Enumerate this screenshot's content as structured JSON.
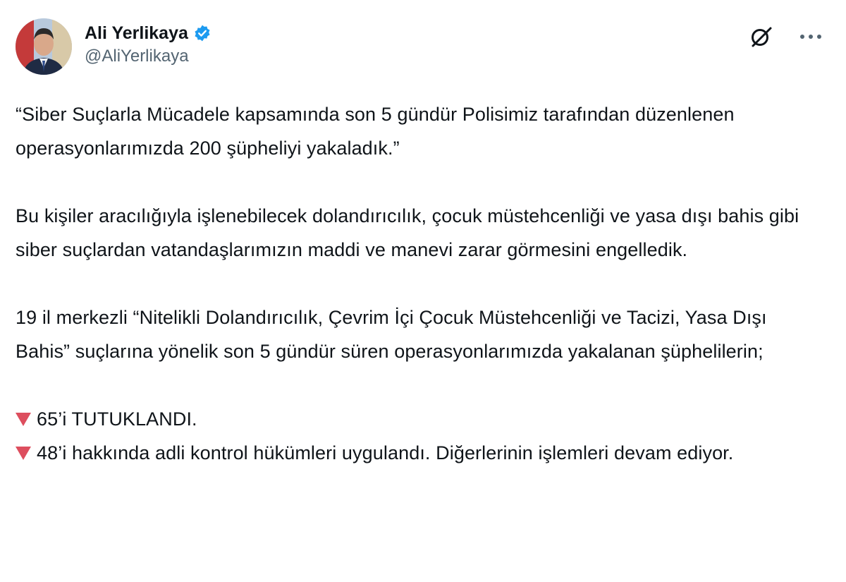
{
  "author": {
    "display_name": "Ali Yerlikaya",
    "handle": "@AliYerlikaya",
    "verified": true,
    "verified_color": "#1d9bf0",
    "avatar_icon": "profile-photo"
  },
  "actions": {
    "grok_icon": "grok-icon",
    "more_icon": "more-horizontal-icon"
  },
  "tweet": {
    "paragraph_1": "“Siber Suçlarla Mücadele kapsamında son 5 gündür Polisimiz tarafından düzenlenen operasyonlarımızda 200 şüpheliyi yakaladık.”",
    "paragraph_2": "Bu kişiler aracılığıyla işlenebilecek dolandırıcılık, çocuk müstehcenliği ve yasa dışı bahis gibi siber suçlardan vatandaşlarımızın maddi ve manevi zarar görmesini engelledik.",
    "paragraph_3": "19 il merkezli “Nitelikli Dolandırıcılık, Çevrim İçi Çocuk Müstehcenliği ve Tacizi, Yasa Dışı Bahis” suçlarına yönelik son 5 gündür süren operasyonlarımızda yakalanan şüphelilerin;",
    "bullet_1": "65’i TUTUKLANDI.",
    "bullet_2": "48’i hakkında adli kontrol hükümleri uygulandı. Diğerlerinin işlemleri devam ediyor.",
    "bullet_color": "#dd4e5e"
  }
}
